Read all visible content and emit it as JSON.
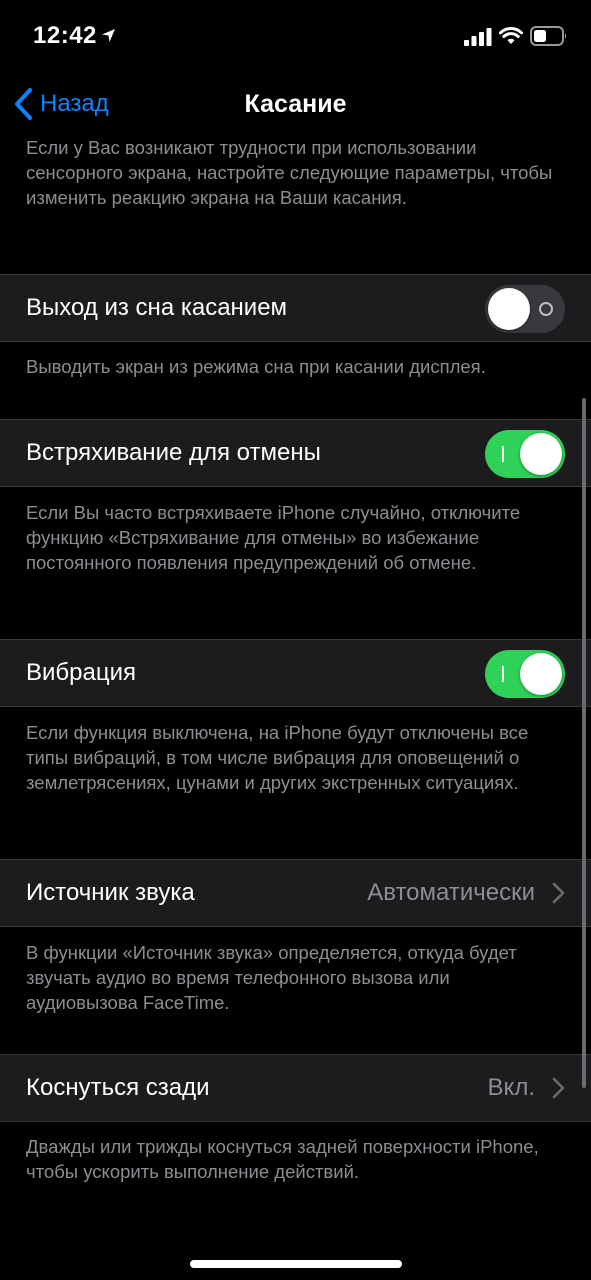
{
  "status_bar": {
    "time": "12:42",
    "icons": [
      "location-arrow-icon",
      "signal-icon",
      "wifi-icon",
      "battery-icon"
    ]
  },
  "nav": {
    "back_label": "Назад",
    "title": "Касание"
  },
  "intro_text": "Если у Вас возникают трудности при использовании сенсорного экрана, настройте следующие параметры, чтобы изменить реакцию экрана на Ваши касания.",
  "settings": {
    "tap_to_wake": {
      "label": "Выход из сна касанием",
      "state": "off",
      "description": "Выводить экран из режима сна при касании дисплея."
    },
    "shake_to_undo": {
      "label": "Встряхивание для отмены",
      "state": "on",
      "description": "Если Вы часто встряхиваете iPhone случайно, отключите функцию «Встряхивание для отмены» во избежание постоянного появления предупреждений об отмене."
    },
    "vibration": {
      "label": "Вибрация",
      "state": "on",
      "description": "Если функция выключена, на iPhone будут отключены все типы вибраций, в том числе вибрация для оповещений о землетрясениях, цунами и других экстренных ситуациях."
    },
    "audio_routing": {
      "label": "Источник звука",
      "value": "Автоматически",
      "description": "В функции «Источник звука» определяется, откуда будет звучать аудио во время телефонного вызова или аудиовызова FaceTime."
    },
    "back_tap": {
      "label": "Коснуться сзади",
      "value": "Вкл.",
      "description": "Дважды или трижды коснуться задней поверхности iPhone, чтобы ускорить выполнение действий."
    }
  },
  "colors": {
    "background": "#000000",
    "cell_background": "#1c1c1e",
    "accent_blue": "#0a84ff",
    "toggle_on": "#30d158",
    "secondary_text": "#8d8d93"
  }
}
